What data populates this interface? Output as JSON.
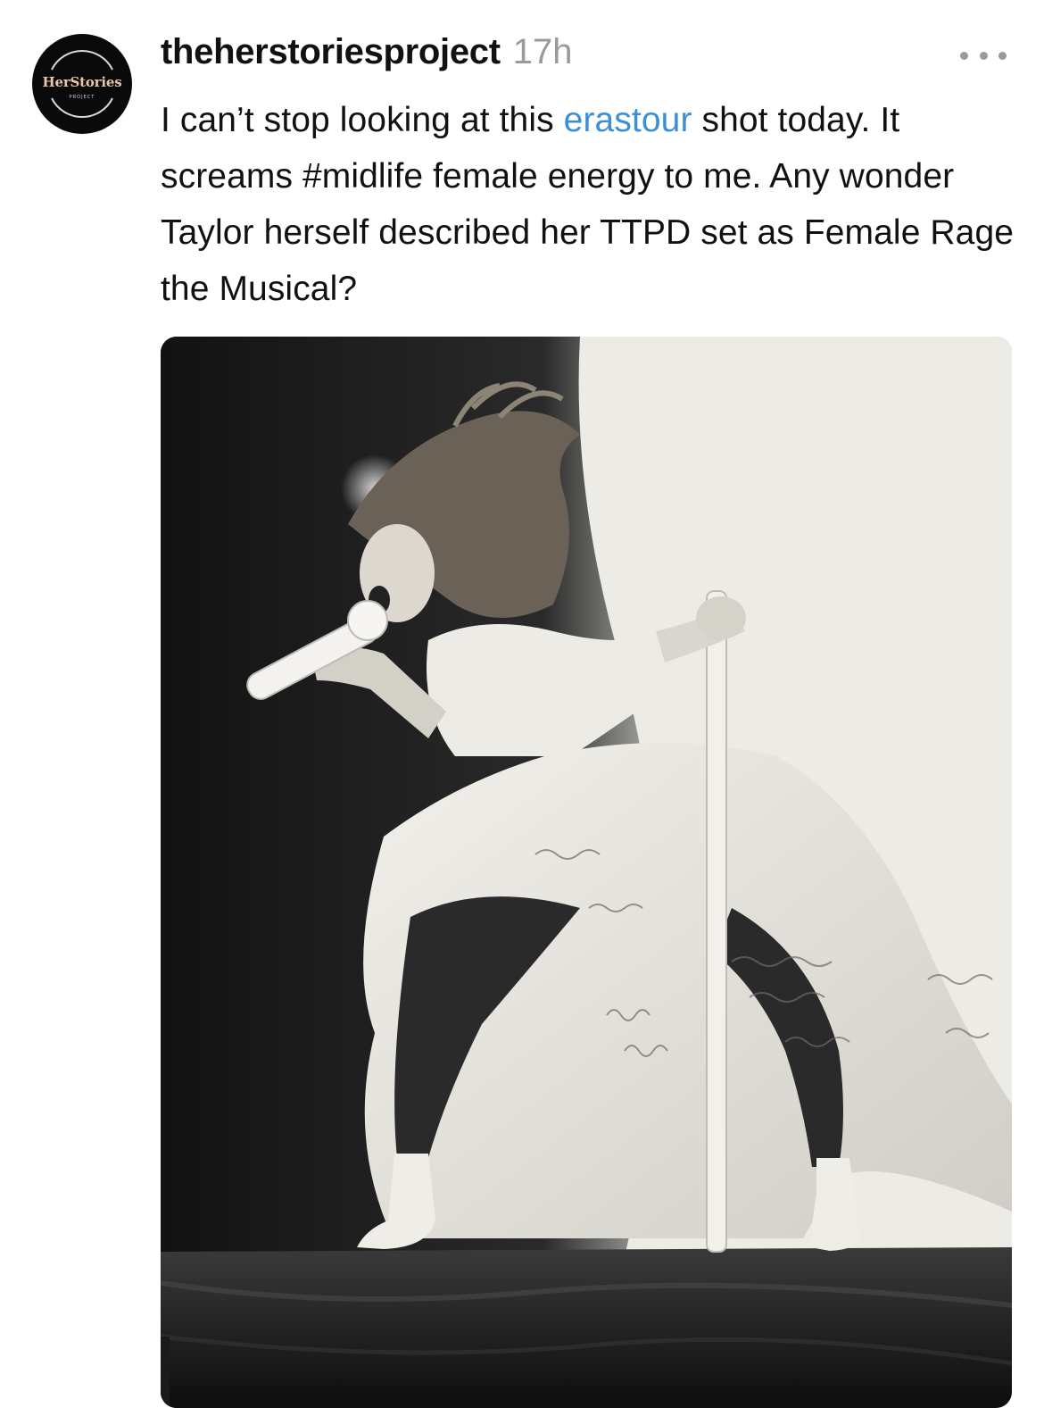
{
  "account": {
    "avatar_wordmark": "HerStories",
    "avatar_sub": "PROJECT",
    "username": "theherstoriesproject",
    "time_ago": "17h"
  },
  "post": {
    "text_before_link": "I can’t stop looking at this ",
    "link_text": "erastour",
    "text_after_link": " shot today. It screams #midlife female energy to me. Any wonder Taylor herself described her TTPD set as Female Rage the Musical?"
  },
  "icons": {
    "more": "more-horizontal-icon"
  },
  "colors": {
    "link": "#3b8fd6",
    "muted": "#9a9a9a",
    "avatar_bg": "#0a0a0a",
    "avatar_gold": "#e6c7a6"
  }
}
